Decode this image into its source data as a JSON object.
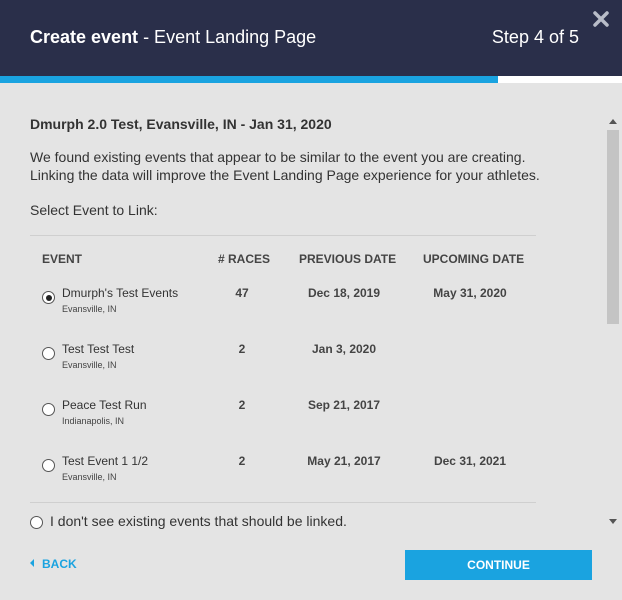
{
  "header": {
    "title_strong": "Create event",
    "title_rest": " - Event Landing Page",
    "step": "Step 4 of 5",
    "close_icon": "close-x-icon"
  },
  "progress": {
    "fraction": 0.8,
    "fill_color": "#1aa3e0",
    "track_color": "#ffffff"
  },
  "content": {
    "event_heading": "Dmurph 2.0 Test, Evansville, IN - Jan 31, 2020",
    "intro": "We found existing events that appear to be similar to the event you are creating. Linking the data will improve the Event Landing Page experience for your athletes.",
    "select_label": "Select Event to Link:"
  },
  "table": {
    "headers": {
      "event": "EVENT",
      "races": "# RACES",
      "previous": "PREVIOUS DATE",
      "upcoming": "UPCOMING DATE"
    },
    "rows": [
      {
        "name": "Dmurph's Test Events",
        "location": "Evansville, IN",
        "races": "47",
        "previous": "Dec 18, 2019",
        "upcoming": "May 31, 2020",
        "selected": true
      },
      {
        "name": "Test Test Test",
        "location": "Evansville, IN",
        "races": "2",
        "previous": "Jan 3, 2020",
        "upcoming": "",
        "selected": false
      },
      {
        "name": "Peace Test Run",
        "location": "Indianapolis, IN",
        "races": "2",
        "previous": "Sep 21, 2017",
        "upcoming": "",
        "selected": false
      },
      {
        "name": "Test Event 1 1/2",
        "location": "Evansville, IN",
        "races": "2",
        "previous": "May 21, 2017",
        "upcoming": "Dec 31, 2021",
        "selected": false
      }
    ]
  },
  "none_option": {
    "label": "I don't see existing events that should be linked.",
    "selected": false
  },
  "footer": {
    "back_label": "BACK",
    "continue_label": "CONTINUE"
  },
  "colors": {
    "header_bg": "#2a2f4a",
    "accent": "#1aa3e0",
    "page_bg": "#e4e4e4"
  }
}
